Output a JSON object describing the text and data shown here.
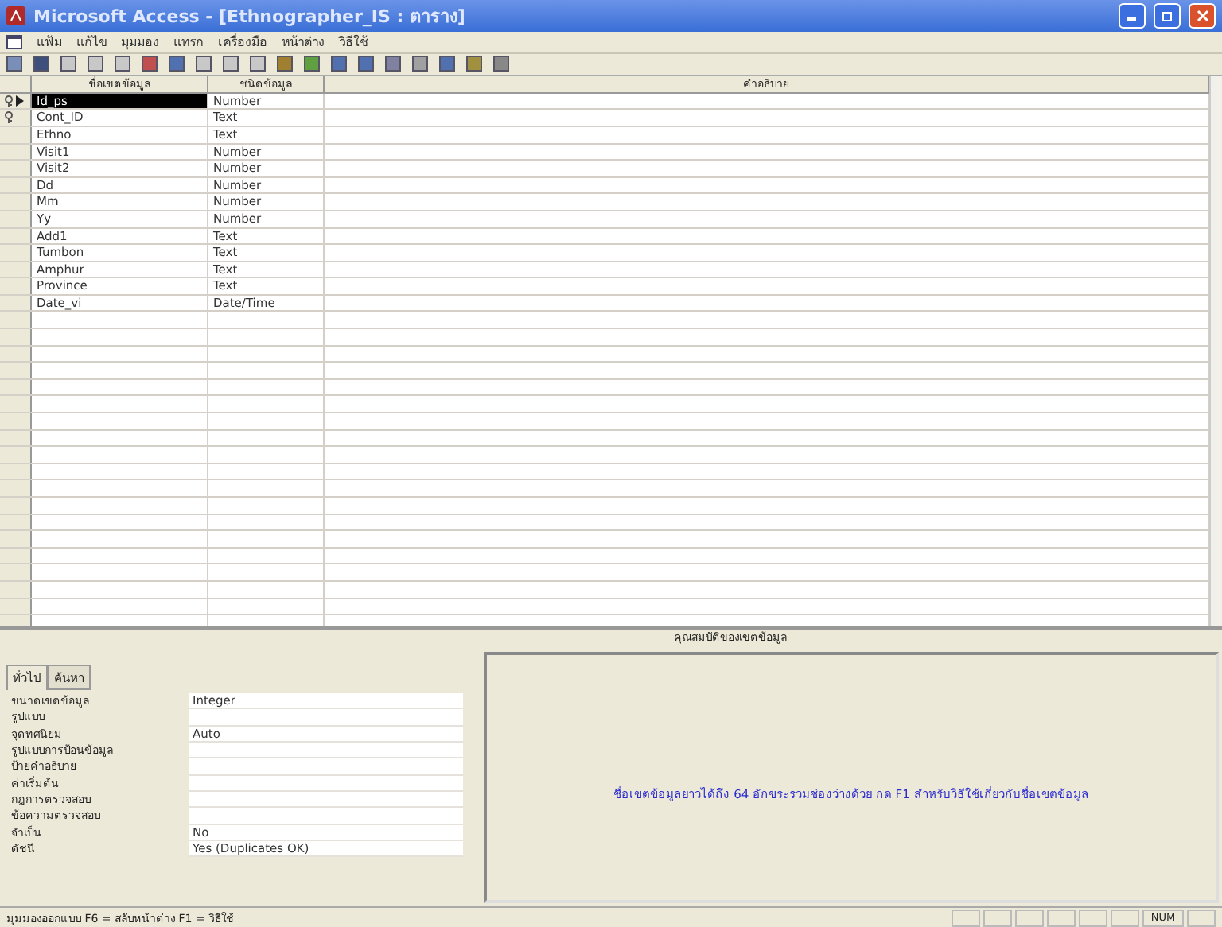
{
  "window": {
    "title": "Microsoft Access - [Ethnographer_IS : ตาราง]"
  },
  "menu": [
    "แฟ้ม",
    "แก้ไข",
    "มุมมอง",
    "แทรก",
    "เครื่องมือ",
    "หน้าต่าง",
    "วิธีใช้"
  ],
  "table": {
    "columns": [
      "ชื่อเขตข้อมูล",
      "ชนิดข้อมูล",
      "คำอธิบาย"
    ],
    "rows": [
      {
        "name": "Id_ps",
        "type": "Number",
        "primary_key": true,
        "selected": true
      },
      {
        "name": "Cont_ID",
        "type": "Text",
        "primary_key": true,
        "selected": false
      },
      {
        "name": "Ethno",
        "type": "Text",
        "primary_key": false,
        "selected": false
      },
      {
        "name": "Visit1",
        "type": "Number",
        "primary_key": false,
        "selected": false
      },
      {
        "name": "Visit2",
        "type": "Number",
        "primary_key": false,
        "selected": false
      },
      {
        "name": "Dd",
        "type": "Number",
        "primary_key": false,
        "selected": false
      },
      {
        "name": "Mm",
        "type": "Number",
        "primary_key": false,
        "selected": false
      },
      {
        "name": "Yy",
        "type": "Number",
        "primary_key": false,
        "selected": false
      },
      {
        "name": "Add1",
        "type": "Text",
        "primary_key": false,
        "selected": false
      },
      {
        "name": "Tumbon",
        "type": "Text",
        "primary_key": false,
        "selected": false
      },
      {
        "name": "Amphur",
        "type": "Text",
        "primary_key": false,
        "selected": false
      },
      {
        "name": "Province",
        "type": "Text",
        "primary_key": false,
        "selected": false
      },
      {
        "name": "Date_vi",
        "type": "Date/Time",
        "primary_key": false,
        "selected": false
      }
    ]
  },
  "properties": {
    "title": "คุณสมบัติของเขตข้อมูล",
    "tabs": [
      {
        "label": "ทั่วไป",
        "selected": true
      },
      {
        "label": "ค้นหา",
        "selected": false
      }
    ],
    "rows": [
      {
        "label": "ขนาดเขตข้อมูล",
        "value": "Integer"
      },
      {
        "label": "รูปแบบ"
      },
      {
        "label": "จุดทศนิยม",
        "value": "Auto"
      },
      {
        "label": "รูปแบบการป้อนข้อมูล"
      },
      {
        "label": "ป้ายคำอธิบาย"
      },
      {
        "label": "ค่าเริ่มต้น"
      },
      {
        "label": "กฎการตรวจสอบ"
      },
      {
        "label": "ข้อความตรวจสอบ"
      },
      {
        "label": "จำเป็น",
        "value": "No"
      },
      {
        "label": "ดัชนี",
        "value": "Yes (Duplicates OK)"
      }
    ],
    "help": "ชื่อเขตข้อมูลยาวได้ถึง 64 อักขระรวมช่องว่างด้วย กด F1 สำหรับวิธีใช้เกี่ยวกับชื่อเขตข้อมูล"
  },
  "status_bar": {
    "text": "มุมมองออกแบบ F6 = สลับหน้าต่าง F1 = วิธีใช้",
    "indicator": "NUM"
  }
}
